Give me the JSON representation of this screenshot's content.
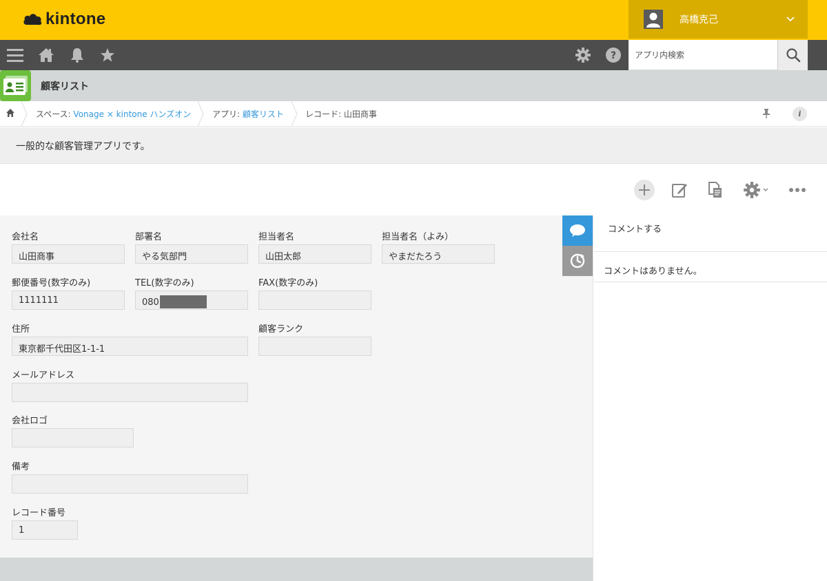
{
  "header": {
    "logo_text": "kintone",
    "user_name": "高橋克己"
  },
  "nav": {
    "search_placeholder": "アプリ内検索"
  },
  "app": {
    "title": "顧客リスト",
    "description": "一般的な顧客管理アプリです。"
  },
  "breadcrumb": {
    "space_prefix": "スペース: ",
    "space_name": "Vonage × kintone ハンズオン",
    "app_prefix": "アプリ: ",
    "app_name": "顧客リスト",
    "record_label": "レコード: 山田商事"
  },
  "record": {
    "fields": {
      "company": {
        "label": "会社名",
        "value": "山田商事"
      },
      "department": {
        "label": "部署名",
        "value": "やる気部門"
      },
      "contact": {
        "label": "担当者名",
        "value": "山田太郎"
      },
      "contact_kana": {
        "label": "担当者名（よみ）",
        "value": "やまだたろう"
      },
      "postal": {
        "label": "郵便番号(数字のみ)",
        "value": "1111111"
      },
      "tel": {
        "label": "TEL(数字のみ)",
        "value": "080"
      },
      "fax": {
        "label": "FAX(数字のみ)",
        "value": ""
      },
      "address": {
        "label": "住所",
        "value": "東京都千代田区1-1-1"
      },
      "rank": {
        "label": "顧客ランク",
        "value": ""
      },
      "email": {
        "label": "メールアドレス",
        "value": ""
      },
      "logo": {
        "label": "会社ロゴ",
        "value": ""
      },
      "notes": {
        "label": "備考",
        "value": ""
      },
      "record_no": {
        "label": "レコード番号",
        "value": "1"
      }
    }
  },
  "side": {
    "comment_button": "コメントする",
    "no_comments": "コメントはありません。"
  },
  "colors": {
    "brand_yellow": "#fec800",
    "nav_dark": "#4d4d4d",
    "link_blue": "#3498db",
    "comment_tab_blue": "#3498db"
  }
}
